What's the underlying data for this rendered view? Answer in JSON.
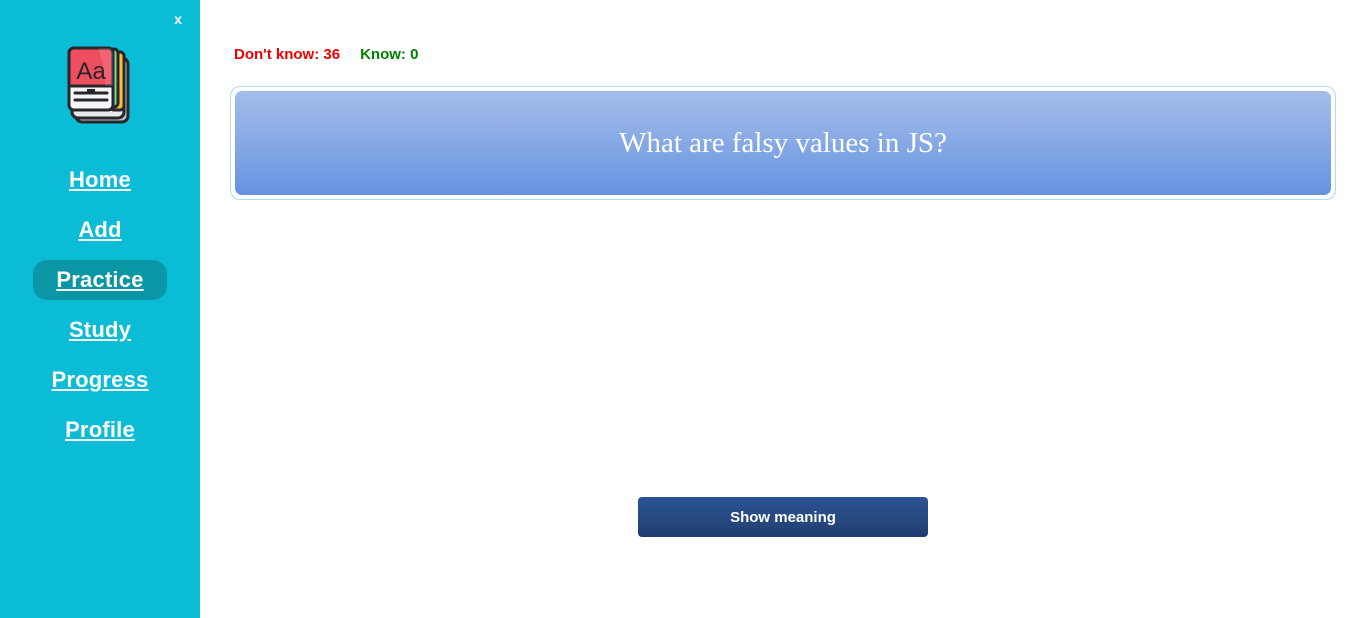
{
  "sidebar": {
    "close_label": "x",
    "logo_icon": "flashcard-stack-icon",
    "logo_letters": "Aa",
    "items": [
      {
        "label": "Home",
        "name": "home",
        "active": false
      },
      {
        "label": "Add",
        "name": "add",
        "active": false
      },
      {
        "label": "Practice",
        "name": "practice",
        "active": true
      },
      {
        "label": "Study",
        "name": "study",
        "active": false
      },
      {
        "label": "Progress",
        "name": "progress",
        "active": false
      },
      {
        "label": "Profile",
        "name": "profile",
        "active": false
      }
    ],
    "background_color": "#0bbcd6",
    "active_color": "#0b96a6"
  },
  "main": {
    "stats": {
      "dont_know_label": "Don't know: 36",
      "know_label": "Know: 0",
      "dont_know_color": "#ee0000",
      "know_color": "#008000"
    },
    "card": {
      "question": "What are falsy values in JS?",
      "border_color": "#aedcf0",
      "gradient_top": "#a4bce9",
      "gradient_bottom": "#6792e1"
    },
    "show_meaning_label": "Show meaning",
    "show_meaning_color": "#27497f"
  }
}
